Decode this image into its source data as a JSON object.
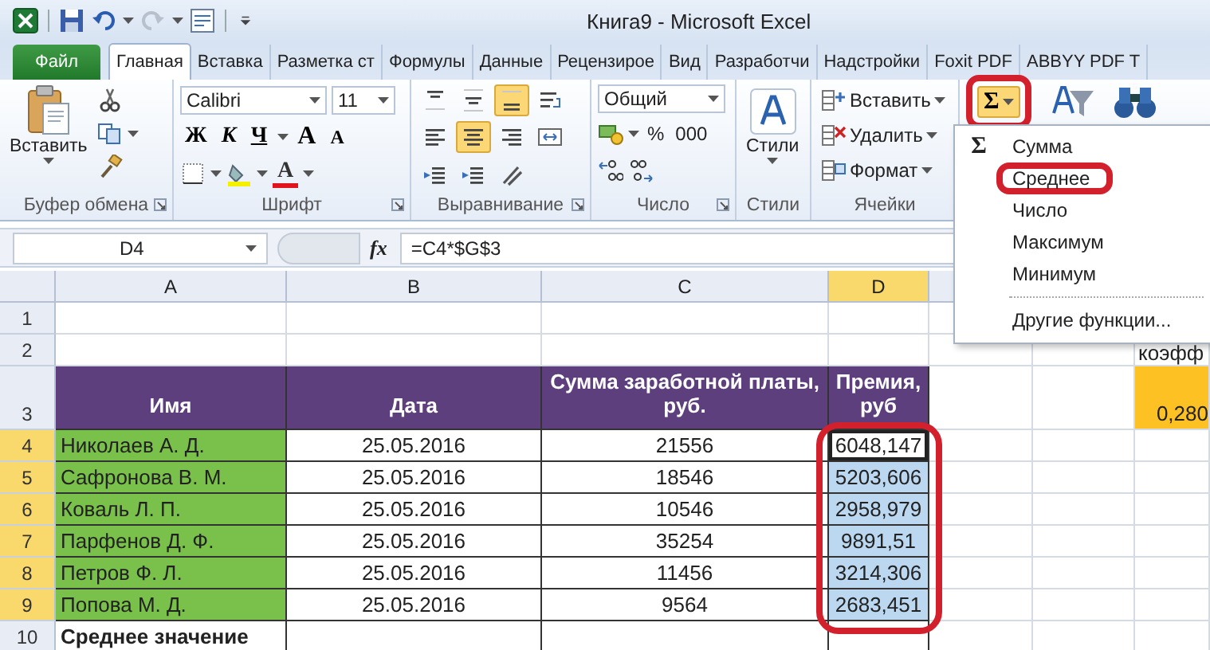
{
  "window": {
    "title": "Книга9 - Microsoft Excel"
  },
  "tabs": [
    {
      "label": "Файл",
      "kind": "file",
      "selected": false
    },
    {
      "label": "Главная",
      "kind": "tab",
      "selected": true
    },
    {
      "label": "Вставка",
      "kind": "tab",
      "selected": false
    },
    {
      "label": "Разметка ст",
      "kind": "tab",
      "selected": false
    },
    {
      "label": "Формулы",
      "kind": "tab",
      "selected": false
    },
    {
      "label": "Данные",
      "kind": "tab",
      "selected": false
    },
    {
      "label": "Рецензирое",
      "kind": "tab",
      "selected": false
    },
    {
      "label": "Вид",
      "kind": "tab",
      "selected": false
    },
    {
      "label": "Разработчи",
      "kind": "tab",
      "selected": false
    },
    {
      "label": "Надстройки",
      "kind": "tab",
      "selected": false
    },
    {
      "label": "Foxit PDF",
      "kind": "tab",
      "selected": false
    },
    {
      "label": "ABBYY PDF T",
      "kind": "tab",
      "selected": false
    }
  ],
  "ribbon": {
    "groups": [
      {
        "kind": "clipboard",
        "label": "Буфер обмена",
        "launcher": true,
        "paste": "Вставить"
      },
      {
        "kind": "font",
        "label": "Шрифт",
        "launcher": true,
        "font": "Calibri",
        "size": "11",
        "style_buttons": [
          {
            "kind": "bold",
            "label": "Ж"
          },
          {
            "kind": "italic",
            "label": "К"
          },
          {
            "kind": "underline",
            "label": "Ч"
          }
        ],
        "grow": "A",
        "shrink": "A",
        "color_button": "A"
      },
      {
        "kind": "alignment",
        "label": "Выравнивание",
        "launcher": true,
        "buttons": [
          {
            "kind": "top",
            "selected": false
          },
          {
            "kind": "middle",
            "selected": false
          },
          {
            "kind": "bottom",
            "selected": true
          },
          {
            "kind": "wrap",
            "selected": false
          },
          {
            "kind": "left",
            "selected": false
          },
          {
            "kind": "center",
            "selected": true
          },
          {
            "kind": "right",
            "selected": false
          },
          {
            "kind": "merge",
            "selected": false
          },
          {
            "kind": "outdent",
            "selected": false
          },
          {
            "kind": "indent",
            "selected": false
          },
          {
            "kind": "orientation",
            "selected": false
          }
        ]
      },
      {
        "kind": "number",
        "label": "Число",
        "launcher": true,
        "format": "Общий",
        "percent": "%",
        "thousands": "000"
      },
      {
        "kind": "styles",
        "label": "Стили",
        "button_label": "Стили"
      },
      {
        "kind": "cells",
        "label": "Ячейки",
        "buttons": [
          {
            "kind": "insert",
            "label": "Вставить"
          },
          {
            "kind": "delete",
            "label": "Удалить"
          },
          {
            "kind": "format",
            "label": "Формат"
          }
        ]
      },
      {
        "kind": "editing",
        "sum": {
          "label": "Σ",
          "selected": true,
          "circled": true
        }
      }
    ]
  },
  "sum_menu": {
    "items": [
      {
        "label": "Сумма",
        "glyph": "Σ",
        "circled": false,
        "separator_before": false
      },
      {
        "label": "Среднее",
        "circled": true,
        "separator_before": false
      },
      {
        "label": "Число",
        "circled": false,
        "separator_before": false
      },
      {
        "label": "Максимум",
        "circled": false,
        "separator_before": false
      },
      {
        "label": "Минимум",
        "circled": false,
        "separator_before": false
      },
      {
        "label": "Другие функции...",
        "circled": false,
        "separator_before": true
      }
    ]
  },
  "formula_bar": {
    "name_box": "D4",
    "fx": "fx",
    "formula": "=C4*$G$3"
  },
  "sheet": {
    "selection_circled": true,
    "columns": [
      {
        "label": "A",
        "selected": false
      },
      {
        "label": "B",
        "selected": false
      },
      {
        "label": "C",
        "selected": false
      },
      {
        "label": "D",
        "selected": true
      }
    ],
    "rows": [
      {
        "number": "1",
        "selected": false,
        "cells": [
          {
            "kind": "plain"
          },
          {
            "kind": "plain"
          },
          {
            "kind": "plain"
          },
          {
            "kind": "plain"
          },
          {
            "kind": "plain"
          },
          {
            "kind": "plain"
          },
          {
            "kind": "plain"
          }
        ]
      },
      {
        "number": "2",
        "selected": false,
        "cells": [
          {
            "kind": "plain"
          },
          {
            "kind": "plain"
          },
          {
            "kind": "plain"
          },
          {
            "kind": "plain"
          },
          {
            "kind": "plain"
          },
          {
            "kind": "plain"
          },
          {
            "kind": "plain",
            "text": "коэфф"
          }
        ]
      },
      {
        "number": "3",
        "selected": false,
        "cells": [
          {
            "kind": "header",
            "text": "Имя"
          },
          {
            "kind": "header",
            "text": "Дата"
          },
          {
            "kind": "header",
            "text": "Сумма заработной платы, руб."
          },
          {
            "kind": "header",
            "text": "Премия, руб"
          },
          {
            "kind": "plain"
          },
          {
            "kind": "plain"
          },
          {
            "kind": "coef",
            "text": "0,280"
          }
        ]
      },
      {
        "number": "4",
        "selected": true,
        "cells": [
          {
            "kind": "name",
            "text": "Николаев А. Д."
          },
          {
            "kind": "data",
            "text": "25.05.2016"
          },
          {
            "kind": "data",
            "text": "21556"
          },
          {
            "kind": "active",
            "text": "6048,147"
          },
          {
            "kind": "plain"
          },
          {
            "kind": "plain"
          },
          {
            "kind": "plain"
          }
        ]
      },
      {
        "number": "5",
        "selected": true,
        "cells": [
          {
            "kind": "name",
            "text": "Сафронова В. М."
          },
          {
            "kind": "data",
            "text": "25.05.2016"
          },
          {
            "kind": "data",
            "text": "18546"
          },
          {
            "kind": "selected",
            "text": "5203,606"
          },
          {
            "kind": "plain"
          },
          {
            "kind": "plain"
          },
          {
            "kind": "plain"
          }
        ]
      },
      {
        "number": "6",
        "selected": true,
        "cells": [
          {
            "kind": "name",
            "text": "Коваль Л. П."
          },
          {
            "kind": "data",
            "text": "25.05.2016"
          },
          {
            "kind": "data",
            "text": "10546"
          },
          {
            "kind": "selected",
            "text": "2958,979"
          },
          {
            "kind": "plain"
          },
          {
            "kind": "plain"
          },
          {
            "kind": "plain"
          }
        ]
      },
      {
        "number": "7",
        "selected": true,
        "cells": [
          {
            "kind": "name",
            "text": "Парфенов Д. Ф."
          },
          {
            "kind": "data",
            "text": "25.05.2016"
          },
          {
            "kind": "data",
            "text": "35254"
          },
          {
            "kind": "selected",
            "text": "9891,51"
          },
          {
            "kind": "plain"
          },
          {
            "kind": "plain"
          },
          {
            "kind": "plain"
          }
        ]
      },
      {
        "number": "8",
        "selected": true,
        "cells": [
          {
            "kind": "name",
            "text": "Петров Ф. Л."
          },
          {
            "kind": "data",
            "text": "25.05.2016"
          },
          {
            "kind": "data",
            "text": "11456"
          },
          {
            "kind": "selected",
            "text": "3214,306"
          },
          {
            "kind": "plain"
          },
          {
            "kind": "plain"
          },
          {
            "kind": "plain"
          }
        ]
      },
      {
        "number": "9",
        "selected": true,
        "cells": [
          {
            "kind": "name",
            "text": "Попова М. Д."
          },
          {
            "kind": "data",
            "text": "25.05.2016"
          },
          {
            "kind": "data",
            "text": "9564"
          },
          {
            "kind": "selected",
            "text": "2683,451"
          },
          {
            "kind": "plain"
          },
          {
            "kind": "plain"
          },
          {
            "kind": "plain"
          }
        ]
      },
      {
        "number": "10",
        "selected": false,
        "cells": [
          {
            "kind": "total",
            "text": "Среднее значение"
          },
          {
            "kind": "data"
          },
          {
            "kind": "data"
          },
          {
            "kind": "data"
          },
          {
            "kind": "plain"
          },
          {
            "kind": "plain"
          },
          {
            "kind": "plain"
          }
        ]
      }
    ]
  }
}
